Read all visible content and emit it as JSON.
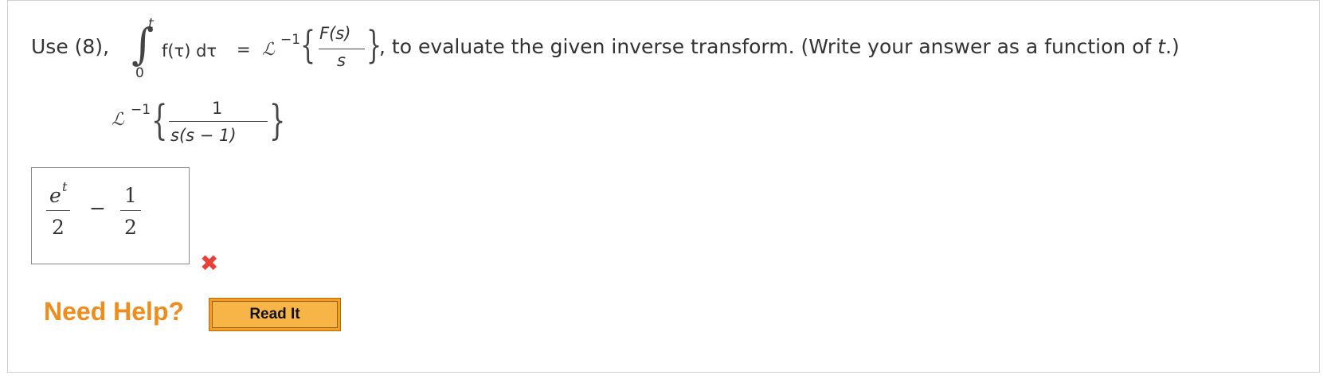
{
  "question": {
    "prefix": "Use (8),",
    "integral_sign": "∫",
    "upper_limit": "t",
    "lower_limit": "0",
    "integrand": "f(τ) dτ",
    "equals": "=",
    "laplace_inv": "ℒ",
    "superscript": "−1",
    "frac_num": "F(s)",
    "frac_den": "s",
    "suffix": ", to evaluate the given inverse transform. (Write your answer as a function of ",
    "var_t": "t",
    "close": ".)"
  },
  "problem": {
    "laplace_inv": "ℒ",
    "superscript": "−1",
    "frac_num": "1",
    "frac_den": "s(s − 1)"
  },
  "answer": {
    "term1_num": "e",
    "term1_sup": "t",
    "term1_den": "2",
    "minus": "−",
    "term2_num": "1",
    "term2_den": "2"
  },
  "status": {
    "incorrect_mark": "✖",
    "incorrect_color": "#e8413b"
  },
  "help": {
    "label": "Need Help?",
    "read_it_label": "Read It"
  },
  "colors": {
    "help_orange": "#ee8d1d",
    "button_orange": "#f29f21"
  }
}
